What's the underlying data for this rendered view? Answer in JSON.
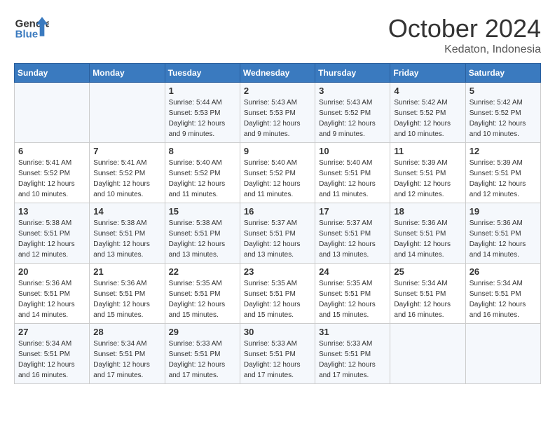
{
  "logo": {
    "line1": "General",
    "line2": "Blue"
  },
  "title": "October 2024",
  "location": "Kedaton, Indonesia",
  "days_header": [
    "Sunday",
    "Monday",
    "Tuesday",
    "Wednesday",
    "Thursday",
    "Friday",
    "Saturday"
  ],
  "weeks": [
    [
      {
        "day": "",
        "sunrise": "",
        "sunset": "",
        "daylight": ""
      },
      {
        "day": "",
        "sunrise": "",
        "sunset": "",
        "daylight": ""
      },
      {
        "day": "1",
        "sunrise": "Sunrise: 5:44 AM",
        "sunset": "Sunset: 5:53 PM",
        "daylight": "Daylight: 12 hours and 9 minutes."
      },
      {
        "day": "2",
        "sunrise": "Sunrise: 5:43 AM",
        "sunset": "Sunset: 5:53 PM",
        "daylight": "Daylight: 12 hours and 9 minutes."
      },
      {
        "day": "3",
        "sunrise": "Sunrise: 5:43 AM",
        "sunset": "Sunset: 5:52 PM",
        "daylight": "Daylight: 12 hours and 9 minutes."
      },
      {
        "day": "4",
        "sunrise": "Sunrise: 5:42 AM",
        "sunset": "Sunset: 5:52 PM",
        "daylight": "Daylight: 12 hours and 10 minutes."
      },
      {
        "day": "5",
        "sunrise": "Sunrise: 5:42 AM",
        "sunset": "Sunset: 5:52 PM",
        "daylight": "Daylight: 12 hours and 10 minutes."
      }
    ],
    [
      {
        "day": "6",
        "sunrise": "Sunrise: 5:41 AM",
        "sunset": "Sunset: 5:52 PM",
        "daylight": "Daylight: 12 hours and 10 minutes."
      },
      {
        "day": "7",
        "sunrise": "Sunrise: 5:41 AM",
        "sunset": "Sunset: 5:52 PM",
        "daylight": "Daylight: 12 hours and 10 minutes."
      },
      {
        "day": "8",
        "sunrise": "Sunrise: 5:40 AM",
        "sunset": "Sunset: 5:52 PM",
        "daylight": "Daylight: 12 hours and 11 minutes."
      },
      {
        "day": "9",
        "sunrise": "Sunrise: 5:40 AM",
        "sunset": "Sunset: 5:52 PM",
        "daylight": "Daylight: 12 hours and 11 minutes."
      },
      {
        "day": "10",
        "sunrise": "Sunrise: 5:40 AM",
        "sunset": "Sunset: 5:51 PM",
        "daylight": "Daylight: 12 hours and 11 minutes."
      },
      {
        "day": "11",
        "sunrise": "Sunrise: 5:39 AM",
        "sunset": "Sunset: 5:51 PM",
        "daylight": "Daylight: 12 hours and 12 minutes."
      },
      {
        "day": "12",
        "sunrise": "Sunrise: 5:39 AM",
        "sunset": "Sunset: 5:51 PM",
        "daylight": "Daylight: 12 hours and 12 minutes."
      }
    ],
    [
      {
        "day": "13",
        "sunrise": "Sunrise: 5:38 AM",
        "sunset": "Sunset: 5:51 PM",
        "daylight": "Daylight: 12 hours and 12 minutes."
      },
      {
        "day": "14",
        "sunrise": "Sunrise: 5:38 AM",
        "sunset": "Sunset: 5:51 PM",
        "daylight": "Daylight: 12 hours and 13 minutes."
      },
      {
        "day": "15",
        "sunrise": "Sunrise: 5:38 AM",
        "sunset": "Sunset: 5:51 PM",
        "daylight": "Daylight: 12 hours and 13 minutes."
      },
      {
        "day": "16",
        "sunrise": "Sunrise: 5:37 AM",
        "sunset": "Sunset: 5:51 PM",
        "daylight": "Daylight: 12 hours and 13 minutes."
      },
      {
        "day": "17",
        "sunrise": "Sunrise: 5:37 AM",
        "sunset": "Sunset: 5:51 PM",
        "daylight": "Daylight: 12 hours and 13 minutes."
      },
      {
        "day": "18",
        "sunrise": "Sunrise: 5:36 AM",
        "sunset": "Sunset: 5:51 PM",
        "daylight": "Daylight: 12 hours and 14 minutes."
      },
      {
        "day": "19",
        "sunrise": "Sunrise: 5:36 AM",
        "sunset": "Sunset: 5:51 PM",
        "daylight": "Daylight: 12 hours and 14 minutes."
      }
    ],
    [
      {
        "day": "20",
        "sunrise": "Sunrise: 5:36 AM",
        "sunset": "Sunset: 5:51 PM",
        "daylight": "Daylight: 12 hours and 14 minutes."
      },
      {
        "day": "21",
        "sunrise": "Sunrise: 5:36 AM",
        "sunset": "Sunset: 5:51 PM",
        "daylight": "Daylight: 12 hours and 15 minutes."
      },
      {
        "day": "22",
        "sunrise": "Sunrise: 5:35 AM",
        "sunset": "Sunset: 5:51 PM",
        "daylight": "Daylight: 12 hours and 15 minutes."
      },
      {
        "day": "23",
        "sunrise": "Sunrise: 5:35 AM",
        "sunset": "Sunset: 5:51 PM",
        "daylight": "Daylight: 12 hours and 15 minutes."
      },
      {
        "day": "24",
        "sunrise": "Sunrise: 5:35 AM",
        "sunset": "Sunset: 5:51 PM",
        "daylight": "Daylight: 12 hours and 15 minutes."
      },
      {
        "day": "25",
        "sunrise": "Sunrise: 5:34 AM",
        "sunset": "Sunset: 5:51 PM",
        "daylight": "Daylight: 12 hours and 16 minutes."
      },
      {
        "day": "26",
        "sunrise": "Sunrise: 5:34 AM",
        "sunset": "Sunset: 5:51 PM",
        "daylight": "Daylight: 12 hours and 16 minutes."
      }
    ],
    [
      {
        "day": "27",
        "sunrise": "Sunrise: 5:34 AM",
        "sunset": "Sunset: 5:51 PM",
        "daylight": "Daylight: 12 hours and 16 minutes."
      },
      {
        "day": "28",
        "sunrise": "Sunrise: 5:34 AM",
        "sunset": "Sunset: 5:51 PM",
        "daylight": "Daylight: 12 hours and 17 minutes."
      },
      {
        "day": "29",
        "sunrise": "Sunrise: 5:33 AM",
        "sunset": "Sunset: 5:51 PM",
        "daylight": "Daylight: 12 hours and 17 minutes."
      },
      {
        "day": "30",
        "sunrise": "Sunrise: 5:33 AM",
        "sunset": "Sunset: 5:51 PM",
        "daylight": "Daylight: 12 hours and 17 minutes."
      },
      {
        "day": "31",
        "sunrise": "Sunrise: 5:33 AM",
        "sunset": "Sunset: 5:51 PM",
        "daylight": "Daylight: 12 hours and 17 minutes."
      },
      {
        "day": "",
        "sunrise": "",
        "sunset": "",
        "daylight": ""
      },
      {
        "day": "",
        "sunrise": "",
        "sunset": "",
        "daylight": ""
      }
    ]
  ]
}
